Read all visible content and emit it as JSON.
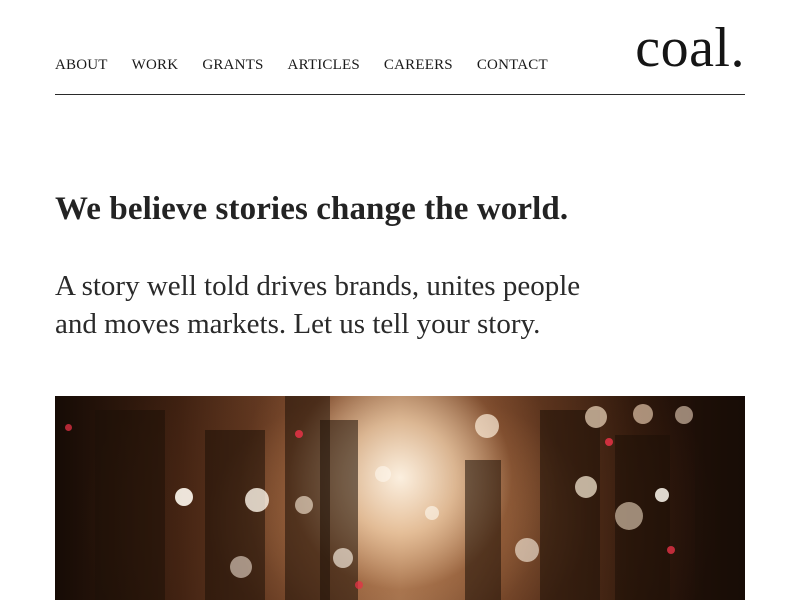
{
  "header": {
    "logo": "coal.",
    "nav": [
      {
        "label": "ABOUT"
      },
      {
        "label": "WORK"
      },
      {
        "label": "GRANTS"
      },
      {
        "label": "ARTICLES"
      },
      {
        "label": "CAREERS"
      },
      {
        "label": "CONTACT"
      }
    ]
  },
  "hero": {
    "headline": "We believe stories change the world.",
    "tagline_line1": "A story well told drives brands, unites people",
    "tagline_line2": "and moves markets. Let us tell your story."
  },
  "colors": {
    "text": "#1f1f1f",
    "divider": "#2a2a2a",
    "background": "#ffffff"
  }
}
